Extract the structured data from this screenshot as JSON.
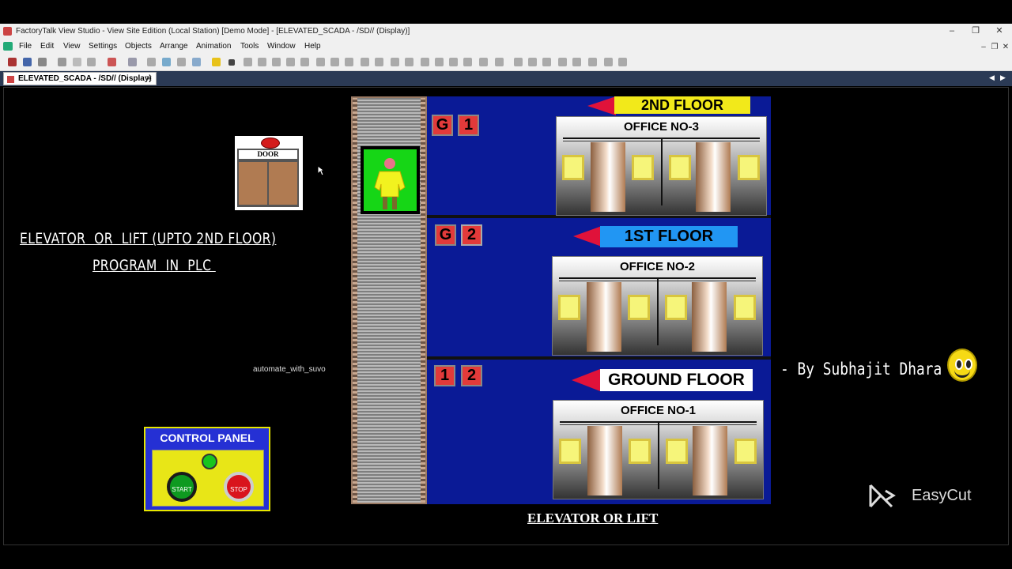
{
  "window": {
    "title": "FactoryTalk View Studio - View Site Edition (Local Station)  [Demo Mode] - [ELEVATED_SCADA - /SD// (Display)]",
    "minimize": "–",
    "restore": "❐",
    "close": "✕",
    "mdi_minimize": "–",
    "mdi_restore": "❐",
    "mdi_close": "✕"
  },
  "menu": [
    "File",
    "Edit",
    "View",
    "Settings",
    "Objects",
    "Arrange",
    "Animation",
    "Tools",
    "Window",
    "Help"
  ],
  "tab": {
    "label": "ELEVATED_SCADA - /SD// (Display)",
    "close": "✕",
    "nav_left": "◀",
    "nav_right": "▶"
  },
  "display": {
    "door_label": "DOOR",
    "title_line1": "ELEVATOR  OR  LIFT (UPTO 2ND FLOOR)",
    "title_line2": "PROGRAM  IN  PLC ",
    "channel_tag": "automate_with_suvo",
    "control_panel": {
      "title": "CONTROL PANEL",
      "start_label": "START",
      "stop_label": "STOP"
    },
    "call_indicators": {
      "floor2": [
        "G",
        "1"
      ],
      "floor1": [
        "G",
        "2"
      ],
      "ground": [
        "1",
        "2"
      ]
    },
    "floors": [
      {
        "sign": "2ND FLOOR",
        "sign_color": "#f2e91a",
        "office": "OFFICE NO-3"
      },
      {
        "sign": "1ST FLOOR",
        "sign_color": "#2196f3",
        "office": "OFFICE NO-2"
      },
      {
        "sign": "GROUND FLOOR",
        "sign_color": "#ffffff",
        "office": "OFFICE NO-1"
      }
    ],
    "byline": "- By Subhajit Dhara",
    "bottom_caption": "ELEVATOR OR LIFT",
    "easycut": "EasyCut"
  }
}
